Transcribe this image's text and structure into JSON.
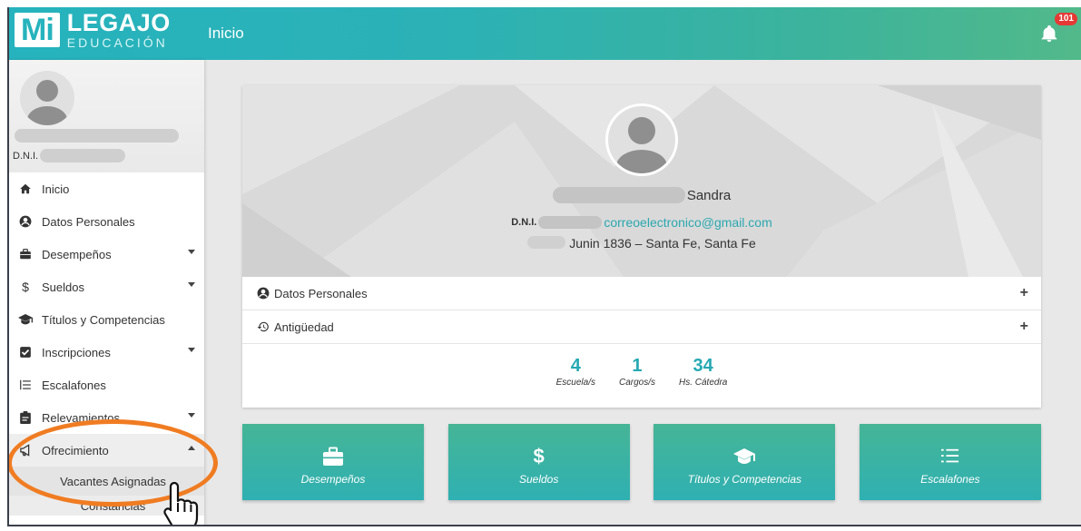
{
  "header": {
    "logo_mi": "Mi",
    "logo_title": "LEGAJO",
    "logo_subtitle": "EDUCACIÓN",
    "page_title": "Inicio",
    "notification_count": "101",
    "accent_color": "#26b3bd"
  },
  "sidebar": {
    "user_dni_label": "D.N.I.",
    "items": [
      {
        "label": "Inicio",
        "icon": "home-icon"
      },
      {
        "label": "Datos Personales",
        "icon": "user-circle-icon"
      },
      {
        "label": "Desempeños",
        "icon": "briefcase-icon"
      },
      {
        "label": "Sueldos",
        "icon": "dollar-icon"
      },
      {
        "label": "Títulos y Competencias",
        "icon": "graduation-cap-icon"
      },
      {
        "label": "Inscripciones",
        "icon": "checkbox-icon"
      },
      {
        "label": "Escalafones",
        "icon": "list-icon"
      },
      {
        "label": "Relevamientos",
        "icon": "clipboard-icon"
      },
      {
        "label": "Ofrecimiento",
        "icon": "megaphone-icon"
      }
    ],
    "subitems": [
      {
        "label": "Vacantes Asignadas"
      },
      {
        "label": "Constancias"
      }
    ]
  },
  "profile": {
    "first_name": "Sandra",
    "dni_label": "D.N.I.",
    "email": "correoelectronico@gmail.com",
    "address": "Junin 1836 – Santa Fe, Santa Fe",
    "sections": [
      {
        "label": "Datos Personales",
        "icon": "user-circle-icon"
      },
      {
        "label": "Antigüedad",
        "icon": "history-icon"
      }
    ],
    "stats": [
      {
        "value": "4",
        "label": "Escuela/s"
      },
      {
        "value": "1",
        "label": "Cargos/s"
      },
      {
        "value": "34",
        "label": "Hs. Cátedra"
      }
    ]
  },
  "tiles": [
    {
      "label": "Desempeños",
      "icon": "briefcase-icon"
    },
    {
      "label": "Sueldos",
      "icon": "dollar-icon"
    },
    {
      "label": "Títulos y Competencias",
      "icon": "graduation-cap-icon"
    },
    {
      "label": "Escalafones",
      "icon": "list-icon"
    }
  ],
  "annotation_color": "#f07c22"
}
